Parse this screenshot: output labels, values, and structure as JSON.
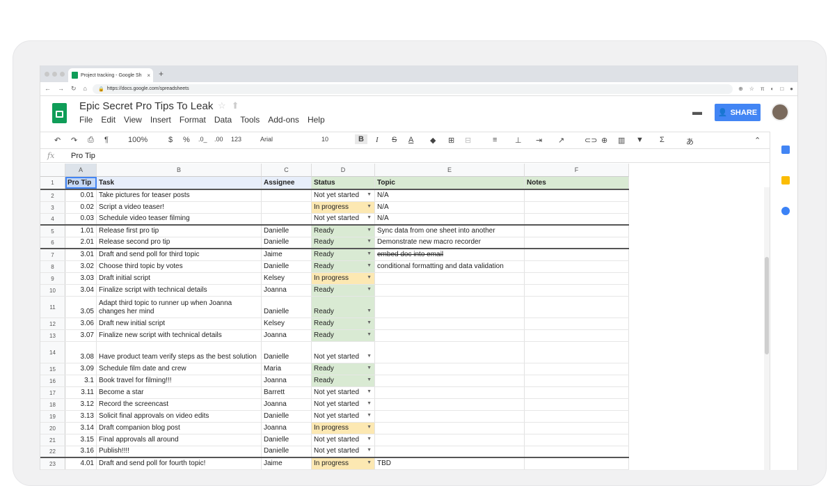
{
  "browser": {
    "tab_title": "Project tracking - Google Sh",
    "tab_close": "×",
    "new_tab": "+",
    "url": "https://docs.google.com/spreadsheets"
  },
  "doc": {
    "title": "Epic Secret Pro Tips To Leak",
    "menu": [
      "File",
      "Edit",
      "View",
      "Insert",
      "Format",
      "Data",
      "Tools",
      "Add-ons",
      "Help"
    ],
    "share_label": "SHARE"
  },
  "toolbar": {
    "zoom": "100%",
    "currency": "$",
    "percent": "%",
    "dec_decrease": ".0_",
    "dec_increase": ".00",
    "more_formats": "123",
    "font": "Arial",
    "font_size": "10",
    "bold": "B",
    "italic": "I",
    "strike": "S",
    "text_color": "A",
    "input_tools": "あ"
  },
  "formula_bar": {
    "fx": "fx",
    "value": "Pro Tip"
  },
  "columns": [
    "A",
    "B",
    "C",
    "D",
    "E",
    "F"
  ],
  "header_row": {
    "num": "1",
    "a": "Pro Tip",
    "b": "Task",
    "c": "Assignee",
    "d": "Status",
    "e": "Topic",
    "f": "Notes"
  },
  "rows": [
    {
      "num": "2",
      "a": "0.01",
      "b": "Take pictures for teaser posts",
      "c": "",
      "d": "Not yet started",
      "e": "N/A"
    },
    {
      "num": "3",
      "a": "0.02",
      "b": "Script a video teaser!",
      "c": "",
      "d": "In progress",
      "e": "N/A"
    },
    {
      "num": "4",
      "a": "0.03",
      "b": "Schedule video teaser filming",
      "c": "",
      "d": "Not yet started",
      "e": "N/A"
    },
    {
      "num": "5",
      "a": "1.01",
      "b": "Release first pro tip",
      "c": "Danielle",
      "d": "Ready",
      "e": "Sync data from one sheet into another"
    },
    {
      "num": "6",
      "a": "2.01",
      "b": "Release second pro tip",
      "c": "Danielle",
      "d": "Ready",
      "e": "Demonstrate new macro recorder"
    },
    {
      "num": "7",
      "a": "3.01",
      "b": "Draft and send poll for third topic",
      "c": "Jaime",
      "d": "Ready",
      "e": "embed doc into email"
    },
    {
      "num": "8",
      "a": "3.02",
      "b": "Choose third topic by votes",
      "c": "Danielle",
      "d": "Ready",
      "e": "conditional formatting and data validation"
    },
    {
      "num": "9",
      "a": "3.03",
      "b": "Draft initial script",
      "c": "Kelsey",
      "d": "In progress",
      "e": ""
    },
    {
      "num": "10",
      "a": "3.04",
      "b": "Finalize script with technical details",
      "c": "Joanna",
      "d": "Ready",
      "e": ""
    },
    {
      "num": "11",
      "a": "3.05",
      "b": "Adapt third topic to runner up when Joanna changes her mind",
      "c": "Danielle",
      "d": "Ready",
      "e": ""
    },
    {
      "num": "12",
      "a": "3.06",
      "b": "Draft new initial script",
      "c": "Kelsey",
      "d": "Ready",
      "e": ""
    },
    {
      "num": "13",
      "a": "3.07",
      "b": "Finalize new script with technical details",
      "c": "Joanna",
      "d": "Ready",
      "e": ""
    },
    {
      "num": "14",
      "a": "3.08",
      "b": "Have product team verify steps as the best solution",
      "c": "Danielle",
      "d": "Not yet started",
      "e": ""
    },
    {
      "num": "15",
      "a": "3.09",
      "b": "Schedule film date and crew",
      "c": "Maria",
      "d": "Ready",
      "e": ""
    },
    {
      "num": "16",
      "a": "3.1",
      "b": "Book travel for filming!!!",
      "c": "Joanna",
      "d": "Ready",
      "e": ""
    },
    {
      "num": "17",
      "a": "3.11",
      "b": "Become a star",
      "c": "Barrett",
      "d": "Not yet started",
      "e": ""
    },
    {
      "num": "18",
      "a": "3.12",
      "b": "Record the screencast",
      "c": "Joanna",
      "d": "Not yet started",
      "e": ""
    },
    {
      "num": "19",
      "a": "3.13",
      "b": "Solicit final approvals on video edits",
      "c": "Danielle",
      "d": "Not yet started",
      "e": ""
    },
    {
      "num": "20",
      "a": "3.14",
      "b": "Draft companion blog post",
      "c": "Joanna",
      "d": "In progress",
      "e": ""
    },
    {
      "num": "21",
      "a": "3.15",
      "b": "Final approvals all around",
      "c": "Danielle",
      "d": "Not yet started",
      "e": ""
    },
    {
      "num": "22",
      "a": "3.16",
      "b": "Publish!!!!",
      "c": "Danielle",
      "d": "Not yet started",
      "e": ""
    },
    {
      "num": "23",
      "a": "4.01",
      "b": "Draft and send poll for fourth topic!",
      "c": "Jaime",
      "d": "In progress",
      "e": "TBD"
    }
  ],
  "colors": {
    "ready": "#d9ead3",
    "in_progress": "#fce8b2",
    "share": "#4285f4",
    "sheets_green": "#0f9d58"
  }
}
